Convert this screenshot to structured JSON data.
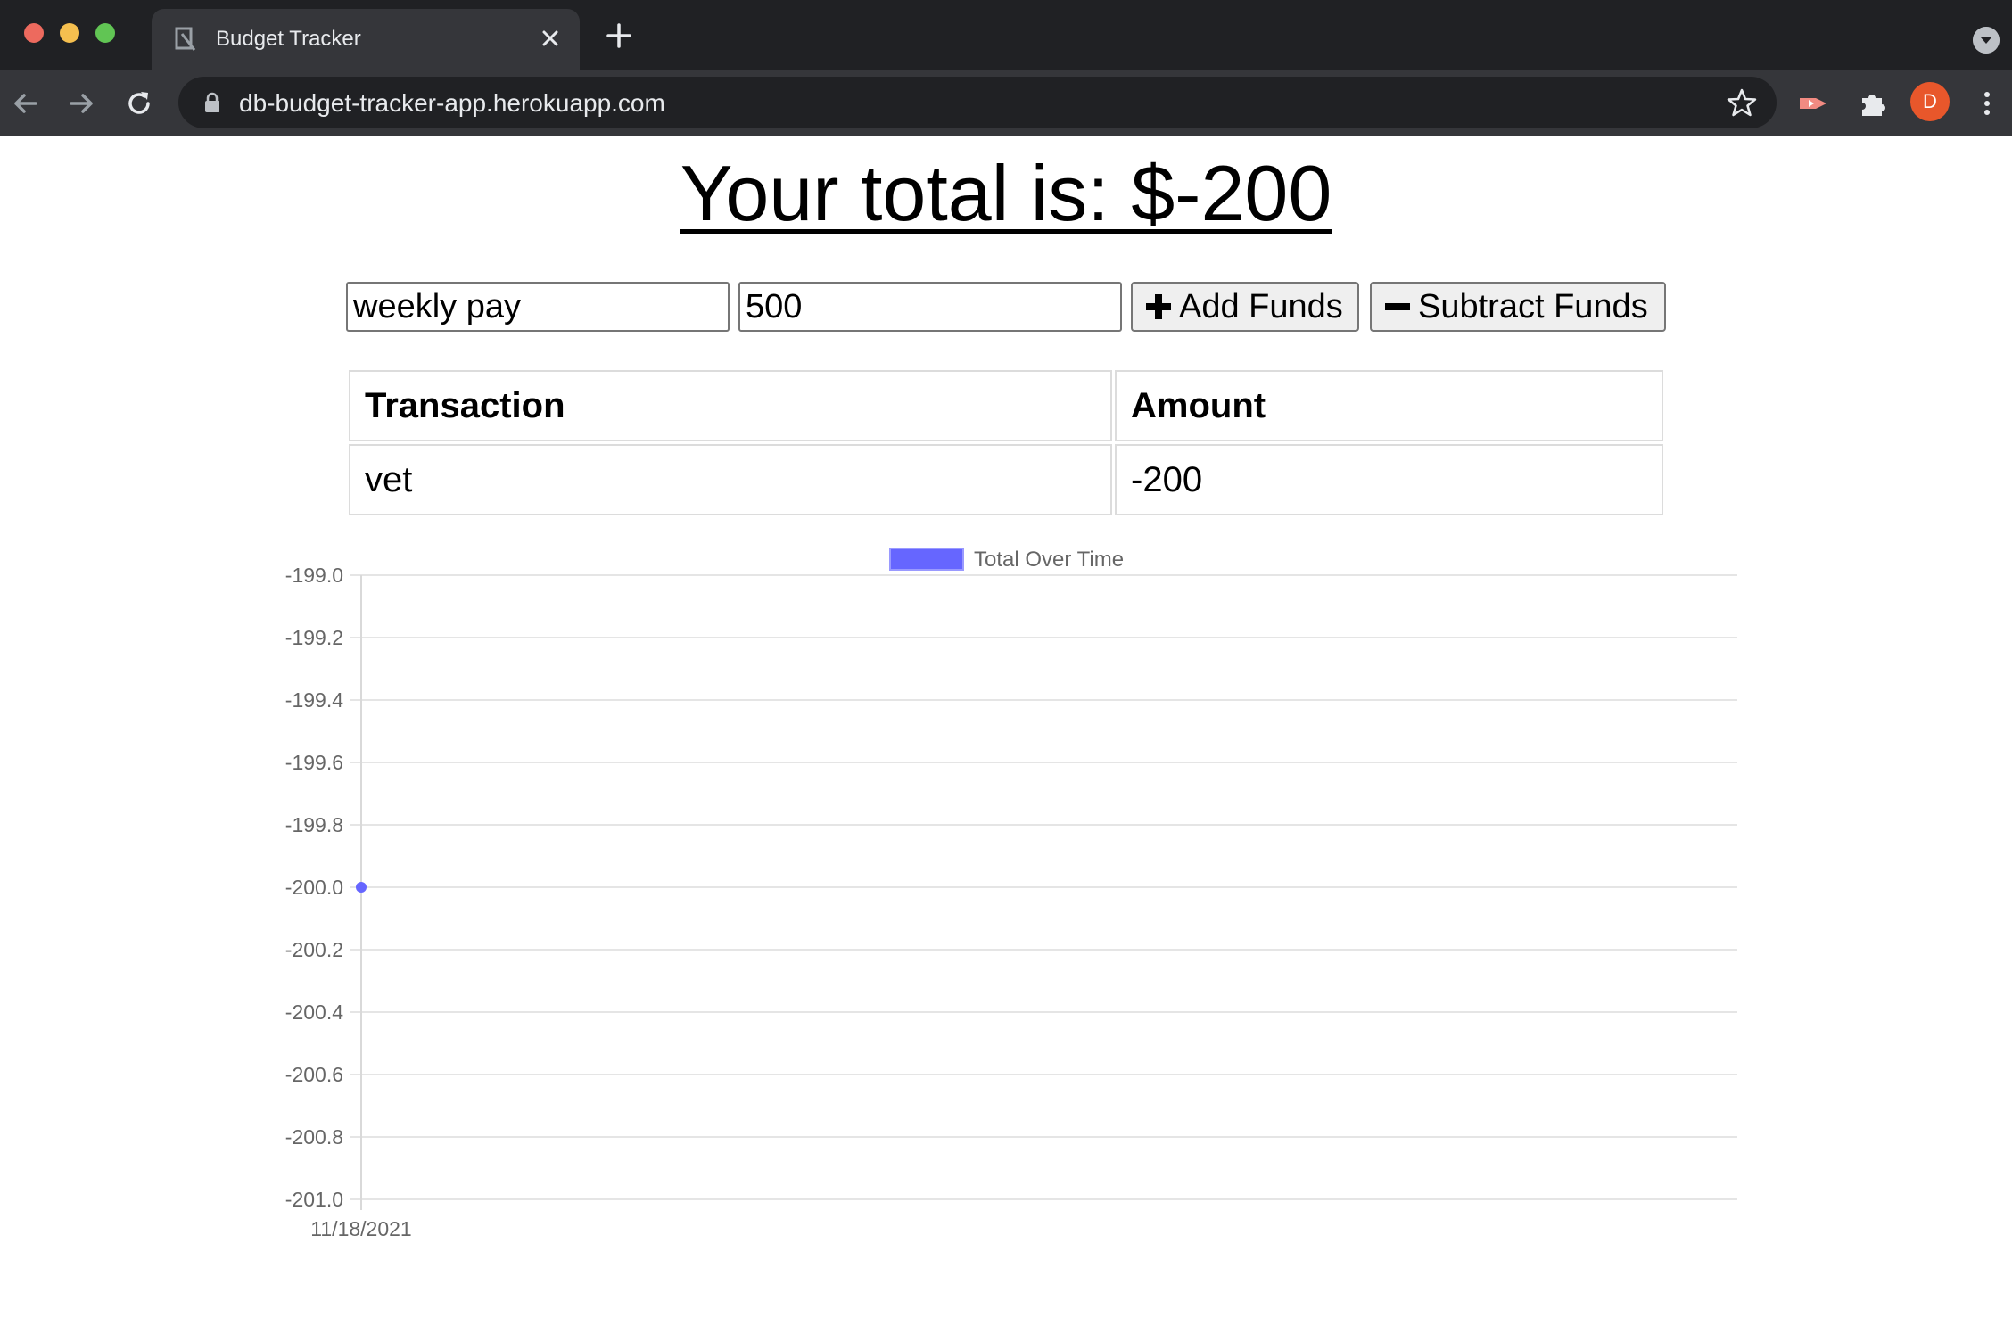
{
  "browser": {
    "tab_title": "Budget Tracker",
    "url": "db-budget-tracker-app.herokuapp.com",
    "profile_initial": "D",
    "icons": [
      "back-arrow-icon",
      "forward-arrow-icon",
      "reload-icon",
      "lock-icon",
      "star-icon",
      "extension-icon",
      "puzzle-icon",
      "kebab-menu-icon",
      "close-icon",
      "plus-icon"
    ]
  },
  "page": {
    "total_label": "Your total is: $",
    "total_value": "-200"
  },
  "form": {
    "name_value": "weekly pay",
    "amount_value": "500",
    "add_label": "Add Funds",
    "subtract_label": "Subtract Funds"
  },
  "table": {
    "headers": [
      "Transaction",
      "Amount"
    ],
    "rows": [
      {
        "transaction": "vet",
        "amount": "-200"
      }
    ]
  },
  "chart_data": {
    "type": "line",
    "legend": "Total Over Time",
    "legend_color": "#6666ff",
    "x": [
      "11/18/2021"
    ],
    "series": [
      {
        "name": "Total Over Time",
        "values": [
          -200
        ]
      }
    ],
    "ylim": [
      -201.0,
      -199.0
    ],
    "yticks": [
      "-199.0",
      "-199.2",
      "-199.4",
      "-199.6",
      "-199.8",
      "-200.0",
      "-200.2",
      "-200.4",
      "-200.6",
      "-200.8",
      "-201.0"
    ],
    "grid": true,
    "legend_position": "top-center"
  }
}
